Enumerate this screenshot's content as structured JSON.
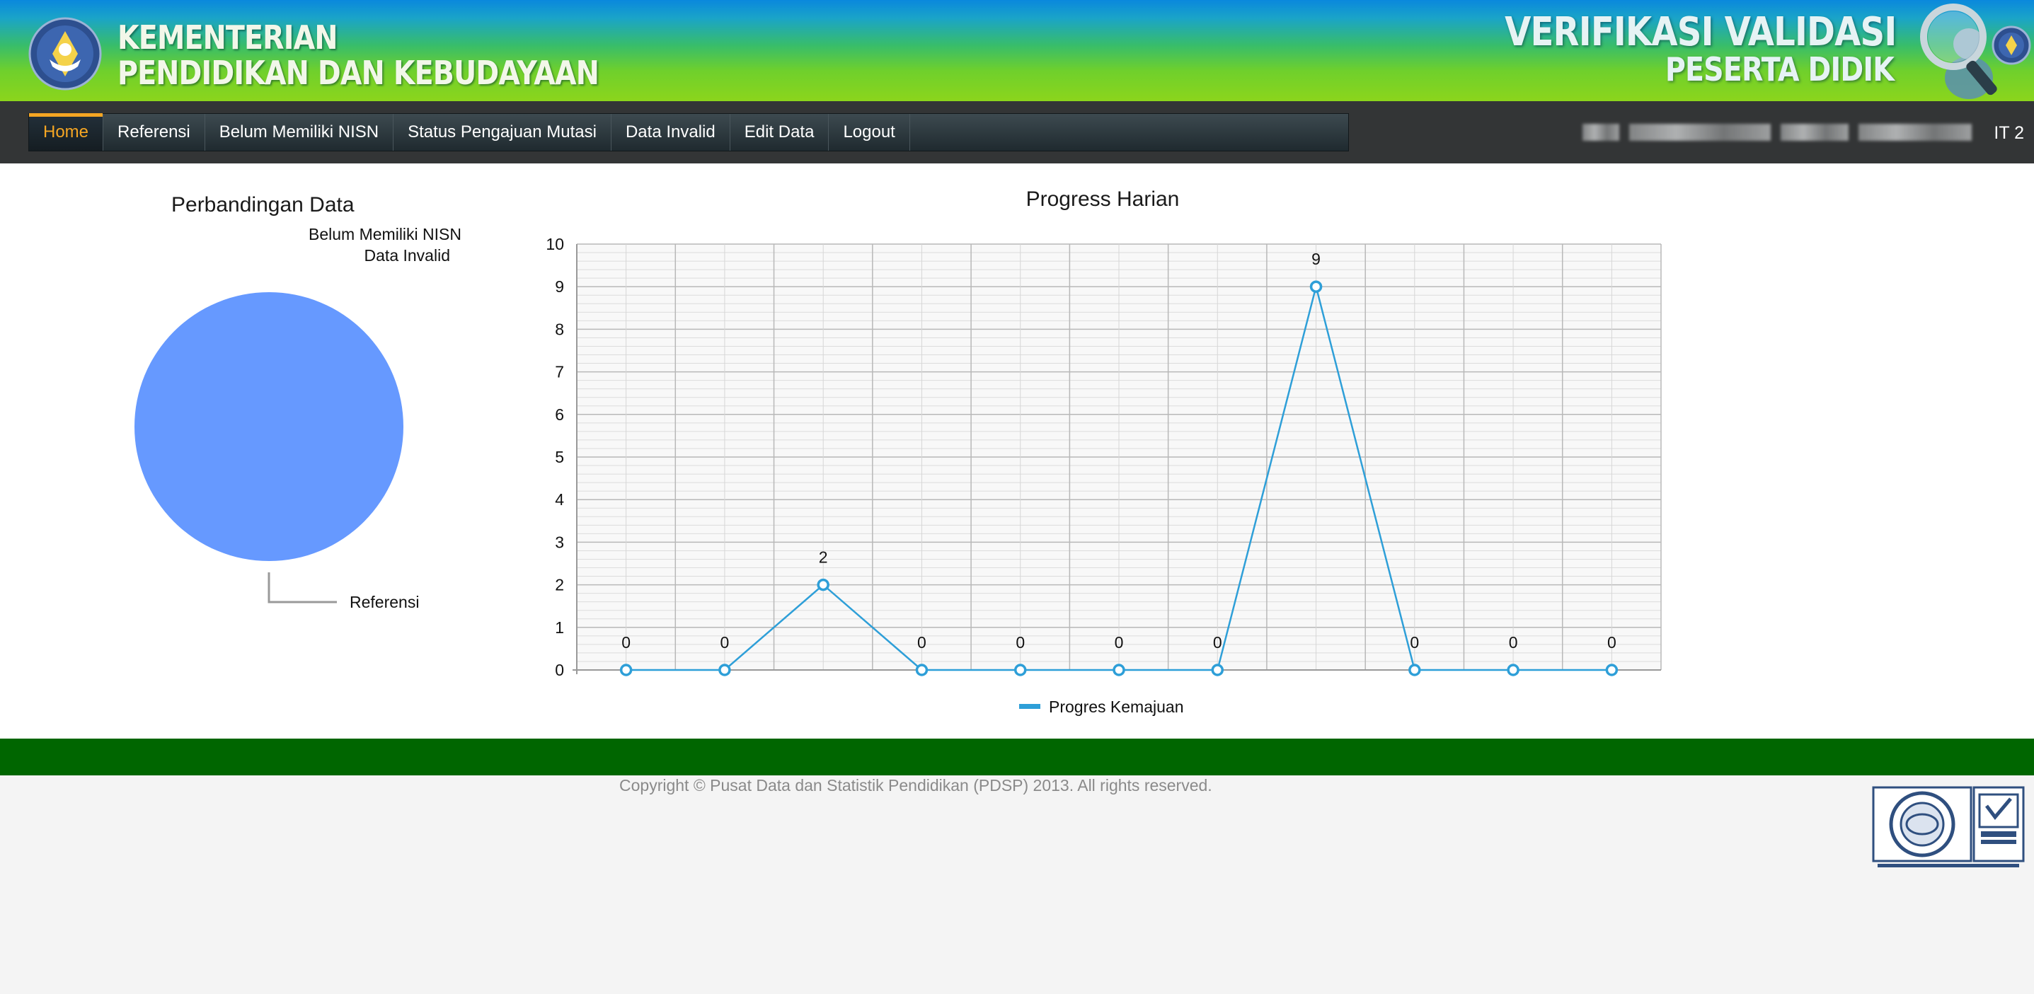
{
  "header": {
    "brand_line1": "KEMENTERIAN",
    "brand_line2": "PENDIDIKAN DAN KEBUDAYAAN",
    "app_line1": "VERIFIKASI VALIDASI",
    "app_line2": "PESERTA DIDIK"
  },
  "nav": {
    "items": [
      {
        "label": "Home",
        "active": true
      },
      {
        "label": "Referensi"
      },
      {
        "label": "Belum Memiliki NISN"
      },
      {
        "label": "Status Pengajuan Mutasi"
      },
      {
        "label": "Data Invalid"
      },
      {
        "label": "Edit Data"
      },
      {
        "label": "Logout"
      }
    ],
    "user_suffix": "IT 2"
  },
  "pie": {
    "title": "Perbandingan Data",
    "legend1": "Belum Memiliki NISN",
    "legend2": "Data Invalid",
    "slice_label": "Referensi"
  },
  "footer": {
    "copyright": "Copyright © Pusat Data dan Statistik Pendidikan (PDSP) 2013. All rights reserved."
  },
  "chart_data": [
    {
      "type": "pie",
      "title": "Perbandingan Data",
      "categories": [
        "Referensi",
        "Belum Memiliki NISN",
        "Data Invalid"
      ],
      "values": [
        100,
        0,
        0
      ],
      "colors": [
        "#6699ff"
      ]
    },
    {
      "type": "line",
      "title": "Progress Harian",
      "series": [
        {
          "name": "Progres Kemajuan",
          "values": [
            0,
            0,
            2,
            0,
            0,
            0,
            0,
            9,
            0,
            0,
            0
          ],
          "color": "#2e9fd8"
        }
      ],
      "point_labels": [
        "0",
        "0",
        "2",
        "0",
        "0",
        "0",
        "0",
        "9",
        "0",
        "0",
        "0"
      ],
      "ylim": [
        0,
        10
      ],
      "yticks": [
        "0",
        "1",
        "2",
        "3",
        "4",
        "5",
        "6",
        "7",
        "8",
        "9",
        "10"
      ],
      "grid": true,
      "legend": "bottom"
    }
  ]
}
